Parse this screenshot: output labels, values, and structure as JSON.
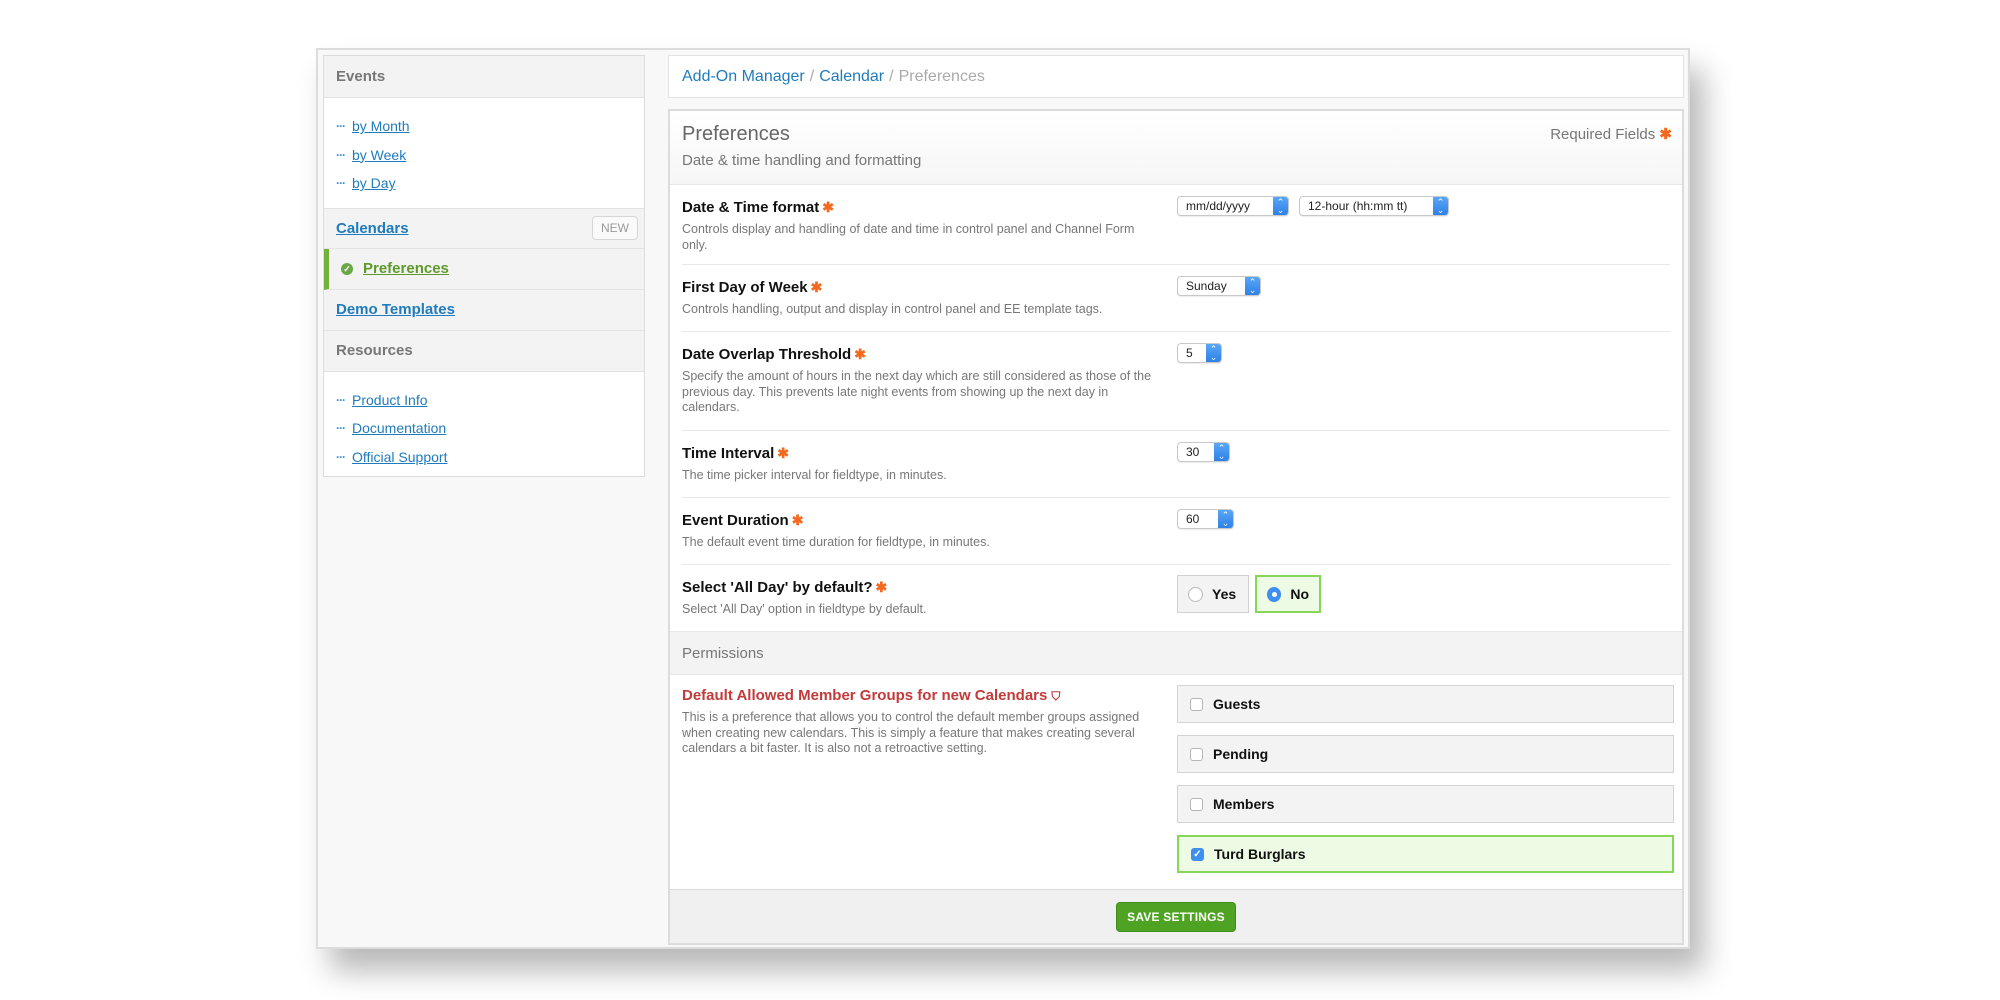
{
  "sidebar": {
    "events_heading": "Events",
    "events_links": [
      {
        "label": "by Month"
      },
      {
        "label": "by Week"
      },
      {
        "label": "by Day"
      }
    ],
    "calendars_label": "Calendars",
    "new_label": "NEW",
    "active_item": "Preferences",
    "demo_templates_label": "Demo Templates",
    "resources_heading": "Resources",
    "resources_links": [
      {
        "label": "Product Info"
      },
      {
        "label": "Documentation"
      },
      {
        "label": "Official Support"
      }
    ]
  },
  "breadcrumb": {
    "items": [
      "Add-On Manager",
      "Calendar"
    ],
    "separator": "/",
    "current": "Preferences"
  },
  "panel": {
    "title": "Preferences",
    "subtitle": "Date & time handling and formatting",
    "required_label": "Required Fields",
    "required_marker": "✱"
  },
  "fields": {
    "date_time_format": {
      "label": "Date & Time format",
      "description": "Controls display and handling of date and time in control panel and Channel Form only.",
      "date_value": "mm/dd/yyyy",
      "time_value": "12-hour (hh:mm tt)"
    },
    "first_day": {
      "label": "First Day of Week",
      "description": "Controls handling, output and display in control panel and EE template tags.",
      "value": "Sunday"
    },
    "overlap": {
      "label": "Date Overlap Threshold",
      "description": "Specify the amount of hours in the next day which are still considered as those of the previous day. This prevents late night events from showing up the next day in calendars.",
      "value": "5"
    },
    "time_interval": {
      "label": "Time Interval",
      "description": "The time picker interval for fieldtype, in minutes.",
      "value": "30"
    },
    "event_duration": {
      "label": "Event Duration",
      "description": "The default event time duration for fieldtype, in minutes.",
      "value": "60"
    },
    "all_day": {
      "label": "Select 'All Day' by default?",
      "description": "Select 'All Day' option in fieldtype by default.",
      "options": [
        "Yes",
        "No"
      ],
      "selected": "No"
    }
  },
  "permissions": {
    "heading": "Permissions",
    "label": "Default Allowed Member Groups for new Calendars",
    "description": "This is a preference that allows you to control the default member groups assigned when creating new calendars. This is simply a feature that makes creating several calendars a bit faster. It is also not a retroactive setting.",
    "groups": [
      {
        "label": "Guests",
        "checked": false
      },
      {
        "label": "Pending",
        "checked": false
      },
      {
        "label": "Members",
        "checked": false
      },
      {
        "label": "Turd Burglars",
        "checked": true
      }
    ]
  },
  "footer": {
    "save_label": "SAVE SETTINGS"
  },
  "colors": {
    "link": "#1f7bbd",
    "required_star": "#f2691f",
    "active_green": "#74b13c",
    "selected_bg": "#eefbe4",
    "selected_border": "#86d65a",
    "save_button": "#4fa323",
    "permission_label": "#c23a3a",
    "select_arrow": "#3d8ff0"
  }
}
